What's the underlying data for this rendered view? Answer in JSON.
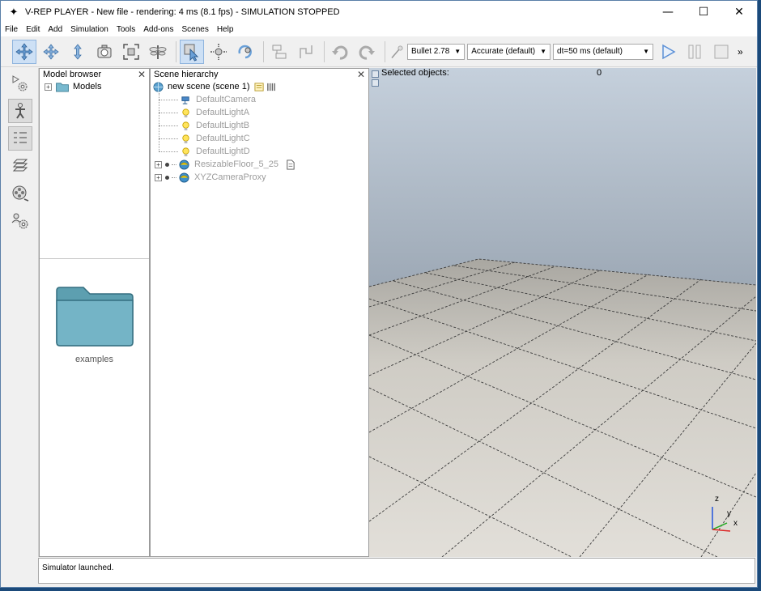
{
  "window": {
    "title": "V-REP PLAYER - New file - rendering: 4 ms (8.1 fps) - SIMULATION STOPPED",
    "minimize": "—",
    "maximize": "☐",
    "close": "✕"
  },
  "menu": [
    "File",
    "Edit",
    "Add",
    "Simulation",
    "Tools",
    "Add-ons",
    "Scenes",
    "Help"
  ],
  "toolbar": {
    "engine": "Bullet 2.78",
    "accuracy": "Accurate (default)",
    "timestep": "dt=50 ms (default)",
    "more": "»"
  },
  "model_browser": {
    "title": "Model browser",
    "close": "✕",
    "root_label": "Models",
    "folder_label": "examples"
  },
  "scene_hierarchy": {
    "title": "Scene hierarchy",
    "close": "✕",
    "scene_label": "new scene (scene 1)",
    "items": [
      {
        "label": "DefaultCamera",
        "icon": "camera-icon"
      },
      {
        "label": "DefaultLightA",
        "icon": "light-icon"
      },
      {
        "label": "DefaultLightB",
        "icon": "light-icon"
      },
      {
        "label": "DefaultLightC",
        "icon": "light-icon"
      },
      {
        "label": "DefaultLightD",
        "icon": "light-icon"
      },
      {
        "label": "ResizableFloor_5_25",
        "icon": "model-icon"
      },
      {
        "label": "XYZCameraProxy",
        "icon": "model-icon"
      }
    ]
  },
  "viewport": {
    "selected_label": "Selected objects:",
    "selected_count": "0",
    "axis_z": "z",
    "axis_y": "y",
    "axis_x": "x"
  },
  "status": {
    "message": "Simulator launched."
  },
  "colors": {
    "sky_top": "#c5d0dc",
    "sky_bottom": "#6c7886",
    "floor": "#d9d6cf",
    "play": "#5a8fd6",
    "folder": "#6aa9bb"
  }
}
